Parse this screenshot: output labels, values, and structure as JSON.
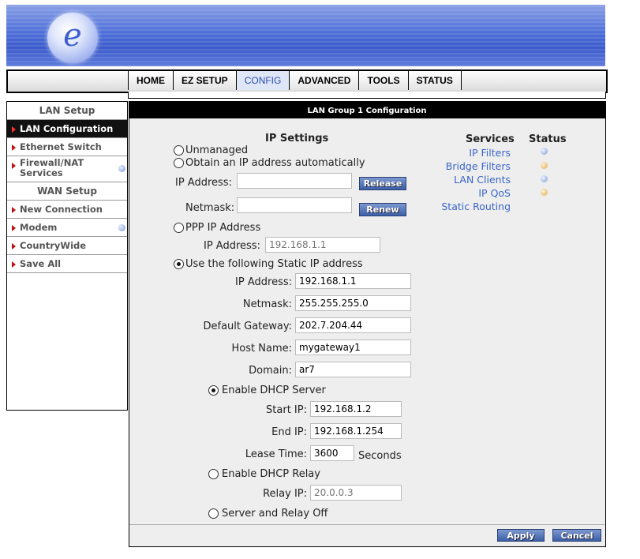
{
  "logo_letter": "e",
  "nav": {
    "tabs": [
      "HOME",
      "EZ SETUP",
      "CONFIG",
      "ADVANCED",
      "TOOLS",
      "STATUS"
    ],
    "active": "CONFIG"
  },
  "sidebar": {
    "lan_setup": "LAN Setup",
    "lan_configuration": "LAN Configuration",
    "ethernet_switch": "Ethernet Switch",
    "firewall_nat_1": "Firewall/NAT",
    "firewall_nat_2": "Services",
    "wan_setup": "WAN Setup",
    "new_connection": "New Connection",
    "modem": "Modem",
    "countrywide": "CountryWide",
    "save_all": "Save All"
  },
  "panel": {
    "title": "LAN Group 1 Configuration"
  },
  "ip_settings": {
    "heading": "IP Settings",
    "unmanaged": "Unmanaged",
    "obtain_auto": "Obtain an IP address automatically",
    "ip_address_label": "IP Address:",
    "netmask_label": "Netmask:",
    "release_label": "Release",
    "renew_label": "Renew",
    "ppp_label": "PPP IP Address",
    "ppp_ip_label": "IP Address:",
    "ppp_ip_placeholder": "192.168.1.1",
    "static_label": "Use the following Static IP address",
    "static_ip_label": "IP Address:",
    "static_ip_value": "192.168.1.1",
    "static_netmask_label": "Netmask:",
    "static_netmask_value": "255.255.255.0",
    "gateway_label": "Default Gateway:",
    "gateway_value": "202.7.204.44",
    "hostname_label": "Host Name:",
    "hostname_value": "mygateway1",
    "domain_label": "Domain:",
    "domain_value": "ar7",
    "selected_mode": "static"
  },
  "dhcp": {
    "enable_server_label": "Enable DHCP Server",
    "start_ip_label": "Start IP:",
    "start_ip_value": "192.168.1.2",
    "end_ip_label": "End IP:",
    "end_ip_value": "192.168.1.254",
    "lease_label": "Lease Time:",
    "lease_value": "3600",
    "lease_unit": "Seconds",
    "enable_relay_label": "Enable DHCP Relay",
    "relay_ip_label": "Relay IP:",
    "relay_ip_placeholder": "20.0.0.3",
    "off_label": "Server and Relay Off",
    "selected_mode": "server"
  },
  "services": {
    "heading": "Services",
    "status_heading": "Status",
    "items": [
      {
        "label": "IP Filters",
        "status_color": "#7e9ad8"
      },
      {
        "label": "Bridge Filters",
        "status_color": "#e0a845"
      },
      {
        "label": "LAN Clients",
        "status_color": "#7e9ad8"
      },
      {
        "label": "IP QoS",
        "status_color": "#e0a845"
      },
      {
        "label": "Static Routing",
        "status_color": ""
      }
    ]
  },
  "actions": {
    "apply_label": "Apply",
    "cancel_label": "Cancel"
  }
}
